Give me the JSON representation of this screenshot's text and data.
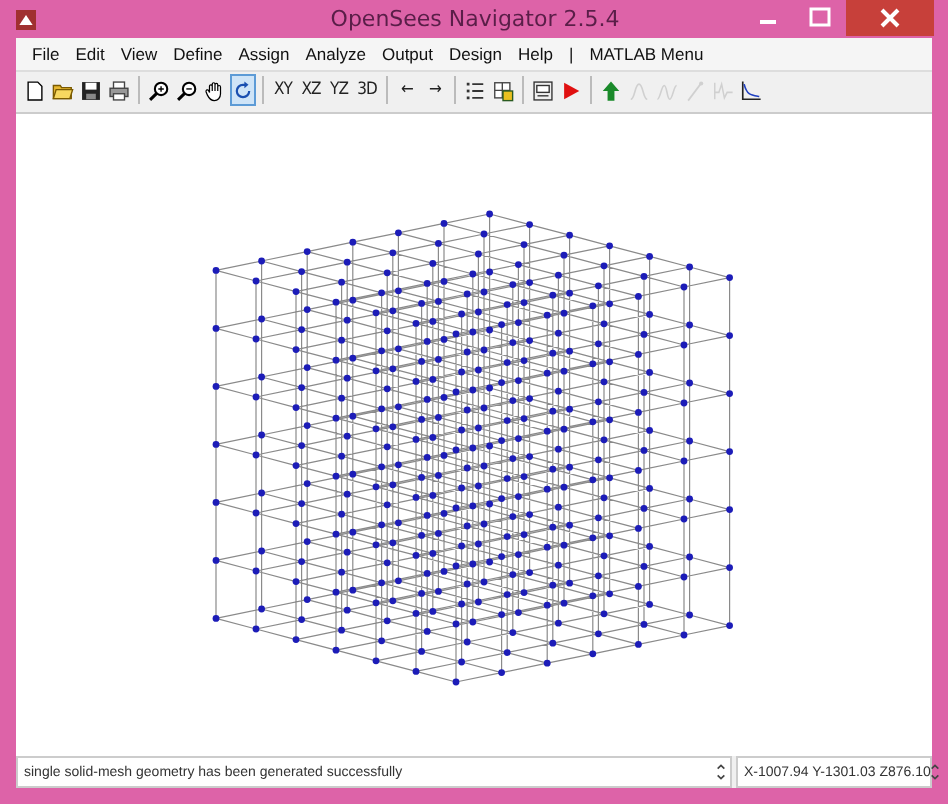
{
  "window": {
    "title": "OpenSees Navigator 2.5.4"
  },
  "menu": [
    "File",
    "Edit",
    "View",
    "Define",
    "Assign",
    "Analyze",
    "Output",
    "Design",
    "Help",
    "|",
    "MATLAB Menu"
  ],
  "toolbar_groups": [
    {
      "buttons": [
        {
          "kind": "icon",
          "selected": false,
          "disabled": false
        },
        {
          "kind": "icon",
          "selected": false,
          "disabled": false
        },
        {
          "kind": "icon",
          "selected": false,
          "disabled": false
        },
        {
          "kind": "icon",
          "selected": false,
          "disabled": false
        }
      ]
    },
    {
      "buttons": [
        {
          "kind": "icon",
          "selected": false,
          "disabled": false
        },
        {
          "kind": "icon",
          "selected": false,
          "disabled": false
        },
        {
          "kind": "icon",
          "selected": false,
          "disabled": false
        },
        {
          "kind": "icon",
          "selected": true,
          "disabled": false
        }
      ]
    },
    {
      "buttons": [
        {
          "kind": "text",
          "label": "XY",
          "selected": false,
          "disabled": false
        },
        {
          "kind": "text",
          "label": "XZ",
          "selected": false,
          "disabled": false
        },
        {
          "kind": "text",
          "label": "YZ",
          "selected": false,
          "disabled": false
        },
        {
          "kind": "text",
          "label": "3D",
          "selected": false,
          "disabled": false
        }
      ]
    },
    {
      "buttons": [
        {
          "kind": "text",
          "label": "←",
          "selected": false,
          "disabled": false
        },
        {
          "kind": "text",
          "label": "→",
          "selected": false,
          "disabled": false
        }
      ]
    },
    {
      "buttons": [
        {
          "kind": "icon",
          "selected": false,
          "disabled": false
        },
        {
          "kind": "icon",
          "selected": false,
          "disabled": false
        }
      ]
    },
    {
      "buttons": [
        {
          "kind": "icon",
          "selected": false,
          "disabled": false
        },
        {
          "kind": "icon",
          "selected": false,
          "disabled": false
        }
      ]
    },
    {
      "buttons": [
        {
          "kind": "icon",
          "selected": false,
          "disabled": false
        },
        {
          "kind": "icon",
          "selected": false,
          "disabled": true
        },
        {
          "kind": "icon",
          "selected": false,
          "disabled": true
        },
        {
          "kind": "icon",
          "selected": false,
          "disabled": true
        },
        {
          "kind": "icon",
          "selected": false,
          "disabled": true
        },
        {
          "kind": "icon",
          "selected": false,
          "disabled": false
        }
      ]
    }
  ],
  "status_bar": {
    "message": "single solid-mesh geometry has been generated successfully",
    "coordinates": "X-1007.94 Y-1301.03 Z876.10"
  }
}
